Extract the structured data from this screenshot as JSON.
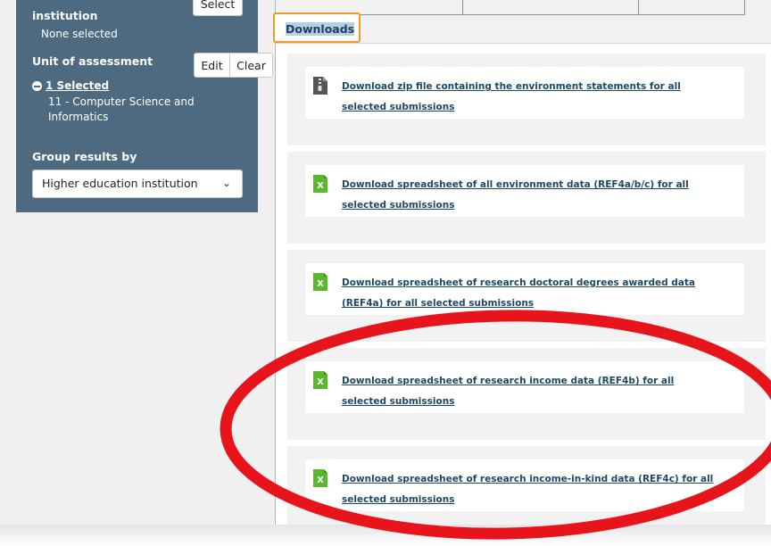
{
  "sidebar": {
    "institution_label": "institution",
    "institution_value": "None selected",
    "select_button": "Select",
    "uoa_label": "Unit of assessment",
    "edit_button": "Edit",
    "clear_button": "Clear",
    "selected_count_link": "1 Selected",
    "selected_item": "11 - Computer Science and Informatics",
    "group_label": "Group results by",
    "group_value": "Higher education institution"
  },
  "tabs": {
    "active_label": "Downloads"
  },
  "downloads": [
    {
      "icon": "zip-file-icon",
      "text": "Download zip file containing the environment statements for all selected submissions"
    },
    {
      "icon": "excel-file-icon",
      "text": "Download spreadsheet of all environment data (REF4a/b/c) for all selected submissions"
    },
    {
      "icon": "excel-file-icon",
      "text": "Download spreadsheet of research doctoral degrees awarded data (REF4a) for all selected submissions"
    },
    {
      "icon": "excel-file-icon",
      "text": "Download spreadsheet of research income data (REF4b) for all selected submissions"
    },
    {
      "icon": "excel-file-icon",
      "text": "Download spreadsheet of research income-in-kind data (REF4c) for all selected submissions"
    }
  ],
  "colors": {
    "panel": "#4d6a80",
    "tab_highlight": "#ee9a2b",
    "link": "#1f4866",
    "excel": "#5ab82d",
    "annotation": "#e8141c"
  }
}
